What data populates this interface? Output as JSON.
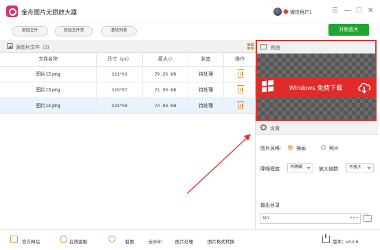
{
  "app": {
    "title": "金舟图片无损放大器",
    "user_name": "微信用户1",
    "controls": {
      "menu": "☰",
      "minimize": "—",
      "maximize": "☐",
      "close": "✕"
    }
  },
  "toolbar": {
    "add_file": "添加文件",
    "add_folder": "添加文件夹",
    "clear_list": "清除列表",
    "start": "开始放大"
  },
  "list": {
    "title": "源图片文件（3）",
    "columns": [
      "文件名称",
      "尺寸（px）",
      "原大小",
      "状态",
      "操作"
    ],
    "rows": [
      {
        "name": "图片12.png",
        "size": "321*63",
        "original": "79.26 KB",
        "status": "待处理",
        "selected": false
      },
      {
        "name": "图片13.png",
        "size": "320*57",
        "original": "71.50 KB",
        "status": "待处理",
        "selected": false
      },
      {
        "name": "图片14.png",
        "size": "324*59",
        "original": "74.93 KB",
        "status": "待处理",
        "selected": true
      }
    ]
  },
  "preview": {
    "label": "预览",
    "banner_text": "Windows  免费下载"
  },
  "settings": {
    "label": "设置",
    "style_label": "图片风格:",
    "style_options": [
      "插画",
      "照片"
    ],
    "style_selected": "插画",
    "noise_label": "降噪程度:",
    "noise_value": "不降噪",
    "scale_label": "放大倍数:",
    "scale_value": "不放大",
    "output_label": "输出目录",
    "output_path": "D:\\",
    "browse": "•••"
  },
  "statusbar": {
    "website": "官方网站",
    "support": "在线客服",
    "screenshot": "截图",
    "watermark": "去水印",
    "image_process": "图片处理",
    "format_convert": "图片格式转换",
    "version": "版本：v4.2.6"
  },
  "colors": {
    "accent": "#e8912d",
    "start_green": "#1fa531",
    "highlight_red": "#e23232",
    "banner_red": "#e12a2a"
  }
}
